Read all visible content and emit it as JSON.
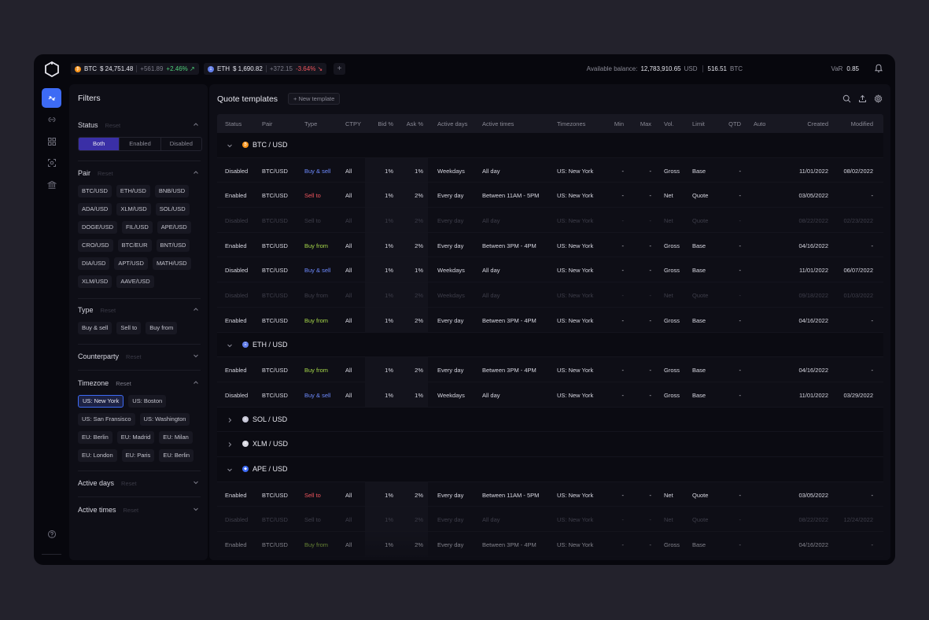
{
  "tickers": [
    {
      "symbol": "BTC",
      "price": "$ 24,751.48",
      "change": "+561.89",
      "pct": "+2.46% ↗",
      "dir": "up",
      "color": "#f7931a",
      "glyph": "₿"
    },
    {
      "symbol": "ETH",
      "price": "$ 1,690.82",
      "change": "+372.15",
      "pct": "-3.64% ↘",
      "dir": "down",
      "color": "#627eea",
      "glyph": "Ξ"
    }
  ],
  "add_ticker": "+",
  "balance": {
    "label": "Available balance:",
    "usd_value": "12,783,910.65",
    "usd_unit": "USD",
    "btc_value": "516.51",
    "btc_unit": "BTC"
  },
  "var": {
    "label": "VaR",
    "value": "0.85"
  },
  "rail": {
    "icons": [
      "swap-icon",
      "link-icon",
      "grid-icon",
      "scan-icon",
      "bank-icon"
    ],
    "help_icon": "help-icon",
    "avatar": "AV"
  },
  "filters": {
    "title": "Filters",
    "status": {
      "title": "Status",
      "reset": "Reset",
      "options": [
        "Both",
        "Enabled",
        "Disabled"
      ],
      "selected": "Both"
    },
    "pair": {
      "title": "Pair",
      "reset": "Reset",
      "chips": [
        "BTC/USD",
        "ETH/USD",
        "BNB/USD",
        "ADA/USD",
        "XLM/USD",
        "SOL/USD",
        "DOGE/USD",
        "FIL/USD",
        "APE/USD",
        "CRO/USD",
        "BTC/EUR",
        "BNT/USD",
        "DIA/USD",
        "APT/USD",
        "MATH/USD",
        "XLM/USD",
        "AAVE/USD"
      ]
    },
    "type": {
      "title": "Type",
      "reset": "Reset",
      "chips": [
        "Buy & sell",
        "Sell to",
        "Buy from"
      ]
    },
    "counterparty": {
      "title": "Counterparty",
      "reset": "Reset"
    },
    "timezone": {
      "title": "Timezone",
      "reset": "Reset",
      "chips": [
        "US: New York",
        "US: Boston",
        "US:  San Fransisco",
        "US: Washington",
        "EU: Berlin",
        "EU: Madrid",
        "EU: Milan",
        "EU: London",
        "EU: Paris",
        "EU: Berlin"
      ],
      "selected_index": 0
    },
    "active_days": {
      "title": "Active days",
      "reset": "Reset"
    },
    "active_times": {
      "title": "Active times",
      "reset": "Reset"
    }
  },
  "main": {
    "title": "Quote templates",
    "new_template": "+ New template",
    "tools": [
      "search-icon",
      "upload-icon",
      "settings-icon"
    ],
    "columns": [
      "Status",
      "Pair",
      "Type",
      "CTPY",
      "Bid %",
      "Ask %",
      "Active days",
      "Active times",
      "Timezones",
      "Min",
      "Max",
      "Vol.",
      "Limit",
      "QTD",
      "Auto",
      "Created",
      "Modified"
    ],
    "groups": [
      {
        "label": "BTC / USD",
        "expanded": true,
        "color": "#f7931a",
        "glyph": "₿",
        "rows": [
          {
            "status": "Disabled",
            "pair": "BTC/USD",
            "type": "Buy & sell",
            "ctpy": "All",
            "bid": "1%",
            "ask": "1%",
            "days": "Weekdays",
            "times": "All day",
            "tz": "US: New York",
            "min": "-",
            "max": "-",
            "vol": "Gross",
            "limit": "Base",
            "qtd": "-",
            "created": "11/01/2022",
            "modified": "08/02/2022",
            "dim": false
          },
          {
            "status": "Enabled",
            "pair": "BTC/USD",
            "type": "Sell to",
            "ctpy": "All",
            "bid": "1%",
            "ask": "2%",
            "days": "Every day",
            "times": "Between 11AM - 5PM",
            "tz": "US: New York",
            "min": "-",
            "max": "-",
            "vol": "Net",
            "limit": "Quote",
            "qtd": "-",
            "created": "03/05/2022",
            "modified": "-",
            "dim": false
          },
          {
            "status": "Disabled",
            "pair": "BTC/USD",
            "type": "Sell to",
            "ctpy": "All",
            "bid": "1%",
            "ask": "2%",
            "days": "Every day",
            "times": "All day",
            "tz": "US: New York",
            "min": "-",
            "max": "-",
            "vol": "Net",
            "limit": "Quote",
            "qtd": "-",
            "created": "08/22/2022",
            "modified": "02/23/2022",
            "dim": true
          },
          {
            "status": "Enabled",
            "pair": "BTC/USD",
            "type": "Buy from",
            "ctpy": "All",
            "bid": "1%",
            "ask": "2%",
            "days": "Every day",
            "times": "Between 3PM - 4PM",
            "tz": "US: New York",
            "min": "-",
            "max": "-",
            "vol": "Gross",
            "limit": "Base",
            "qtd": "-",
            "created": "04/16/2022",
            "modified": "-",
            "dim": false
          },
          {
            "status": "Disabled",
            "pair": "BTC/USD",
            "type": "Buy & sell",
            "ctpy": "All",
            "bid": "1%",
            "ask": "1%",
            "days": "Weekdays",
            "times": "All day",
            "tz": "US: New York",
            "min": "-",
            "max": "-",
            "vol": "Gross",
            "limit": "Base",
            "qtd": "-",
            "created": "11/01/2022",
            "modified": "06/07/2022",
            "dim": false
          },
          {
            "status": "Disabled",
            "pair": "BTC/USD",
            "type": "Buy from",
            "ctpy": "All",
            "bid": "1%",
            "ask": "2%",
            "days": "Weekdays",
            "times": "All day",
            "tz": "US: New York",
            "min": "-",
            "max": "-",
            "vol": "Net",
            "limit": "Quote",
            "qtd": "-",
            "created": "09/18/2022",
            "modified": "01/03/2022",
            "dim": true
          },
          {
            "status": "Enabled",
            "pair": "BTC/USD",
            "type": "Buy from",
            "ctpy": "All",
            "bid": "1%",
            "ask": "2%",
            "days": "Every day",
            "times": "Between 3PM - 4PM",
            "tz": "US: New York",
            "min": "-",
            "max": "-",
            "vol": "Gross",
            "limit": "Base",
            "qtd": "-",
            "created": "04/16/2022",
            "modified": "-",
            "dim": false
          }
        ]
      },
      {
        "label": "ETH / USD",
        "expanded": true,
        "color": "#627eea",
        "glyph": "Ξ",
        "rows": [
          {
            "status": "Enabled",
            "pair": "BTC/USD",
            "type": "Buy from",
            "ctpy": "All",
            "bid": "1%",
            "ask": "2%",
            "days": "Every day",
            "times": "Between 3PM - 4PM",
            "tz": "US: New York",
            "min": "-",
            "max": "-",
            "vol": "Gross",
            "limit": "Base",
            "qtd": "-",
            "created": "04/16/2022",
            "modified": "-",
            "dim": false
          },
          {
            "status": "Disabled",
            "pair": "BTC/USD",
            "type": "Buy & sell",
            "ctpy": "All",
            "bid": "1%",
            "ask": "1%",
            "days": "Weekdays",
            "times": "All day",
            "tz": "US: New York",
            "min": "-",
            "max": "-",
            "vol": "Gross",
            "limit": "Base",
            "qtd": "-",
            "created": "11/01/2022",
            "modified": "03/29/2022",
            "dim": false
          }
        ]
      },
      {
        "label": "SOL / USD",
        "expanded": false,
        "color": "#c8c8d8",
        "glyph": "≡",
        "rows": []
      },
      {
        "label": "XLM / USD",
        "expanded": false,
        "color": "#d8d8e2",
        "glyph": "✶",
        "rows": []
      },
      {
        "label": "APE / USD",
        "expanded": true,
        "color": "#3d6bf5",
        "glyph": "◆",
        "rows": [
          {
            "status": "Enabled",
            "pair": "BTC/USD",
            "type": "Sell to",
            "ctpy": "All",
            "bid": "1%",
            "ask": "2%",
            "days": "Every day",
            "times": "Between 11AM - 5PM",
            "tz": "US: New York",
            "min": "-",
            "max": "-",
            "vol": "Net",
            "limit": "Quote",
            "qtd": "-",
            "created": "03/05/2022",
            "modified": "-",
            "dim": false
          },
          {
            "status": "Disabled",
            "pair": "BTC/USD",
            "type": "Sell to",
            "ctpy": "All",
            "bid": "1%",
            "ask": "2%",
            "days": "Every day",
            "times": "All day",
            "tz": "US: New York",
            "min": "-",
            "max": "-",
            "vol": "Net",
            "limit": "Quote",
            "qtd": "-",
            "created": "08/22/2022",
            "modified": "12/24/2022",
            "dim": true
          },
          {
            "status": "Enabled",
            "pair": "BTC/USD",
            "type": "Buy from",
            "ctpy": "All",
            "bid": "1%",
            "ask": "2%",
            "days": "Every day",
            "times": "Between 3PM - 4PM",
            "tz": "US: New York",
            "min": "-",
            "max": "-",
            "vol": "Gross",
            "limit": "Base",
            "qtd": "-",
            "created": "04/16/2022",
            "modified": "-",
            "dim": false
          }
        ]
      }
    ]
  }
}
